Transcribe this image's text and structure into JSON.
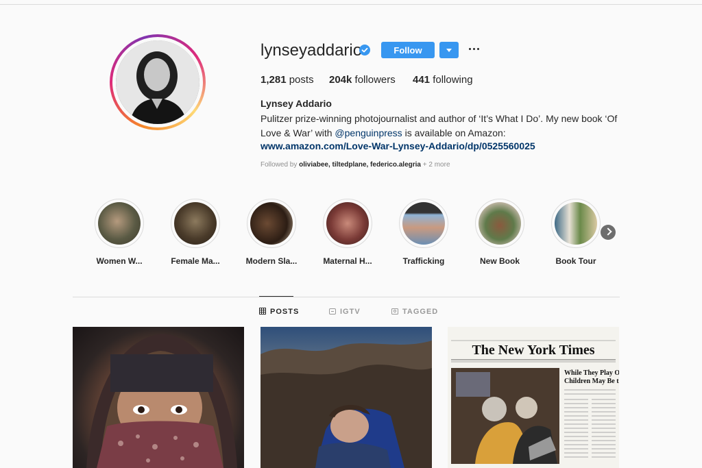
{
  "profile": {
    "username": "lynseyaddario",
    "verified": true,
    "follow_label": "Follow",
    "stats": {
      "posts": "1,281",
      "posts_label": "posts",
      "followers": "204k",
      "followers_label": "followers",
      "following": "441",
      "following_label": "following"
    },
    "full_name": "Lynsey Addario",
    "bio_text_1": "Pulitzer prize-winning photojournalist and author of ‘It’s What I Do’. My new book ‘Of Love & War’ with ",
    "bio_mention": "@penguinpress",
    "bio_text_2": " is available on Amazon:",
    "website": "www.amazon.com/Love-War-Lynsey-Addario/dp/0525560025",
    "followed_by_prefix": "Followed by ",
    "followed_by_users": "oliviabee, tiltedplane, federico.alegria",
    "followed_by_more": " + 2 more"
  },
  "highlights": [
    {
      "label": "Women W..."
    },
    {
      "label": "Female Ma..."
    },
    {
      "label": "Modern Sla..."
    },
    {
      "label": "Maternal H..."
    },
    {
      "label": "Trafficking"
    },
    {
      "label": "New Book"
    },
    {
      "label": "Book Tour"
    }
  ],
  "tabs": {
    "posts": "POSTS",
    "igtv": "IGTV",
    "tagged": "TAGGED"
  },
  "newspaper": {
    "masthead": "The New York Times",
    "headline_1": "While They Play Online,",
    "headline_2": "Children May Be the Pr"
  },
  "colors": {
    "accent": "#3897f0",
    "link": "#003569",
    "text": "#262626",
    "muted": "#8e8e8e"
  }
}
